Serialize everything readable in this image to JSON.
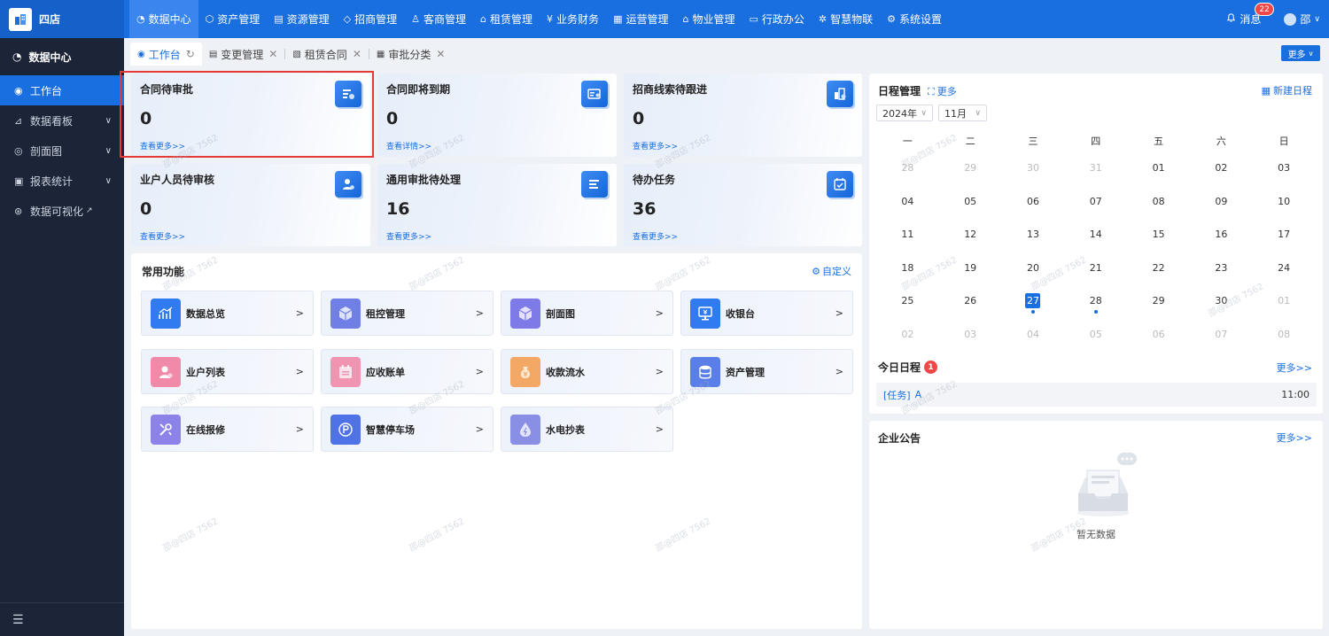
{
  "brand": {
    "name": "四店"
  },
  "topnav": [
    {
      "label": "数据中心",
      "icon": "◔"
    },
    {
      "label": "资产管理",
      "icon": "⬡"
    },
    {
      "label": "资源管理",
      "icon": "▤"
    },
    {
      "label": "招商管理",
      "icon": "◇"
    },
    {
      "label": "客商管理",
      "icon": "♙"
    },
    {
      "label": "租赁管理",
      "icon": "⌂"
    },
    {
      "label": "业务财务",
      "icon": "¥"
    },
    {
      "label": "运营管理",
      "icon": "▦"
    },
    {
      "label": "物业管理",
      "icon": "⌂"
    },
    {
      "label": "行政办公",
      "icon": "▭"
    },
    {
      "label": "智慧物联",
      "icon": "✲"
    },
    {
      "label": "系统设置",
      "icon": "⚙"
    }
  ],
  "header": {
    "messages_label": "消息",
    "messages_count": "22",
    "user_name": "邵"
  },
  "sidebar": {
    "title": "数据中心",
    "items": [
      {
        "label": "工作台",
        "icon": "◉"
      },
      {
        "label": "数据看板",
        "icon": "⊿"
      },
      {
        "label": "剖面图",
        "icon": "◎"
      },
      {
        "label": "报表统计",
        "icon": "▣"
      },
      {
        "label": "数据可视化",
        "icon": "⊛"
      }
    ]
  },
  "tabs": [
    {
      "label": "工作台"
    },
    {
      "label": "变更管理"
    },
    {
      "label": "租赁合同"
    },
    {
      "label": "审批分类"
    }
  ],
  "tabs_more": "更多",
  "stats": [
    {
      "title": "合同待审批",
      "value": "0",
      "link": "查看更多>>"
    },
    {
      "title": "合同即将到期",
      "value": "0",
      "link": "查看详情>>"
    },
    {
      "title": "招商线索待跟进",
      "value": "0",
      "link": "查看更多>>"
    },
    {
      "title": "业户人员待审核",
      "value": "0",
      "link": "查看更多>>"
    },
    {
      "title": "通用审批待处理",
      "value": "16",
      "link": "查看更多>>"
    },
    {
      "title": "待办任务",
      "value": "36",
      "link": "查看更多>>"
    }
  ],
  "functions": {
    "title": "常用功能",
    "customize": "自定义",
    "items": [
      {
        "label": "数据总览",
        "arrow": ">",
        "color": "#2f7bef"
      },
      {
        "label": "租控管理",
        "arrow": ">",
        "color": "#6f7fe6"
      },
      {
        "label": "剖面图",
        "arrow": ">",
        "color": "#7e7be8"
      },
      {
        "label": "收银台",
        "arrow": ">",
        "color": "#2f7bef"
      },
      {
        "label": "业户列表",
        "arrow": ">",
        "color": "#f08aa8"
      },
      {
        "label": "应收账单",
        "arrow": ">",
        "color": "#f094b2"
      },
      {
        "label": "收款流水",
        "arrow": ">",
        "color": "#f3a865"
      },
      {
        "label": "资产管理",
        "arrow": ">",
        "color": "#5b7fe8"
      },
      {
        "label": "在线报修",
        "arrow": ">",
        "color": "#8c83e8"
      },
      {
        "label": "智慧停车场",
        "arrow": ">",
        "color": "#4f73e6"
      },
      {
        "label": "水电抄表",
        "arrow": ">",
        "color": "#8a8fe6"
      }
    ]
  },
  "calendar": {
    "title": "日程管理",
    "more": "更多",
    "new_label": "新建日程",
    "year": "2024年",
    "month": "11月",
    "weekdays": [
      "一",
      "二",
      "三",
      "四",
      "五",
      "六",
      "日"
    ],
    "weeks": [
      [
        "28",
        "29",
        "30",
        "31",
        "01",
        "02",
        "03"
      ],
      [
        "04",
        "05",
        "06",
        "07",
        "08",
        "09",
        "10"
      ],
      [
        "11",
        "12",
        "13",
        "14",
        "15",
        "16",
        "17"
      ],
      [
        "18",
        "19",
        "20",
        "21",
        "22",
        "23",
        "24"
      ],
      [
        "25",
        "26",
        "27",
        "28",
        "29",
        "30",
        "01"
      ],
      [
        "02",
        "03",
        "04",
        "05",
        "06",
        "07",
        "08"
      ]
    ],
    "today": "27"
  },
  "schedule": {
    "title": "今日日程",
    "count": "1",
    "more": "更多>>",
    "items": [
      {
        "tag": "[任务]",
        "name": "A",
        "time": "11:00"
      }
    ]
  },
  "notice": {
    "title": "企业公告",
    "more": "更多>>",
    "empty": "暂无数据"
  },
  "watermark": "邵@四店 7562",
  "colors": {
    "primary": "#1a6fe0",
    "sidebar": "#1c2438",
    "highlight": "#e53935",
    "badge": "#f04848"
  }
}
